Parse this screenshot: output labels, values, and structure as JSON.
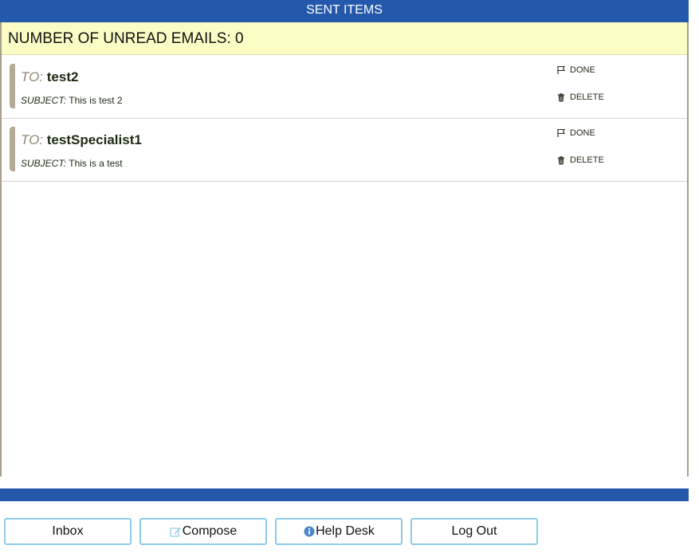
{
  "header": {
    "title": "SENT ITEMS"
  },
  "unread": {
    "text": "NUMBER OF UNREAD EMAILS: 0"
  },
  "emails": [
    {
      "to_label": "TO:",
      "to": "test2",
      "subject_label": "SUBJECT:",
      "subject": "This is test 2",
      "done_label": "DONE",
      "delete_label": "DELETE"
    },
    {
      "to_label": "TO:",
      "to": "testSpecialist1",
      "subject_label": "SUBJECT:",
      "subject": "This is a test",
      "done_label": "DONE",
      "delete_label": "DELETE"
    }
  ],
  "nav": {
    "inbox": "Inbox",
    "compose": "Compose",
    "help_desk": "Help Desk",
    "logout": "Log Out"
  },
  "icons": {
    "done": "flag-icon",
    "delete": "trash-icon",
    "compose": "pencil-icon",
    "help_desk": "info-icon"
  },
  "colors": {
    "header_blue": "#2458ab",
    "unread_bg": "#fbfdc5",
    "accent_bar": "#b3ab93",
    "button_border": "#8ccbe8"
  }
}
